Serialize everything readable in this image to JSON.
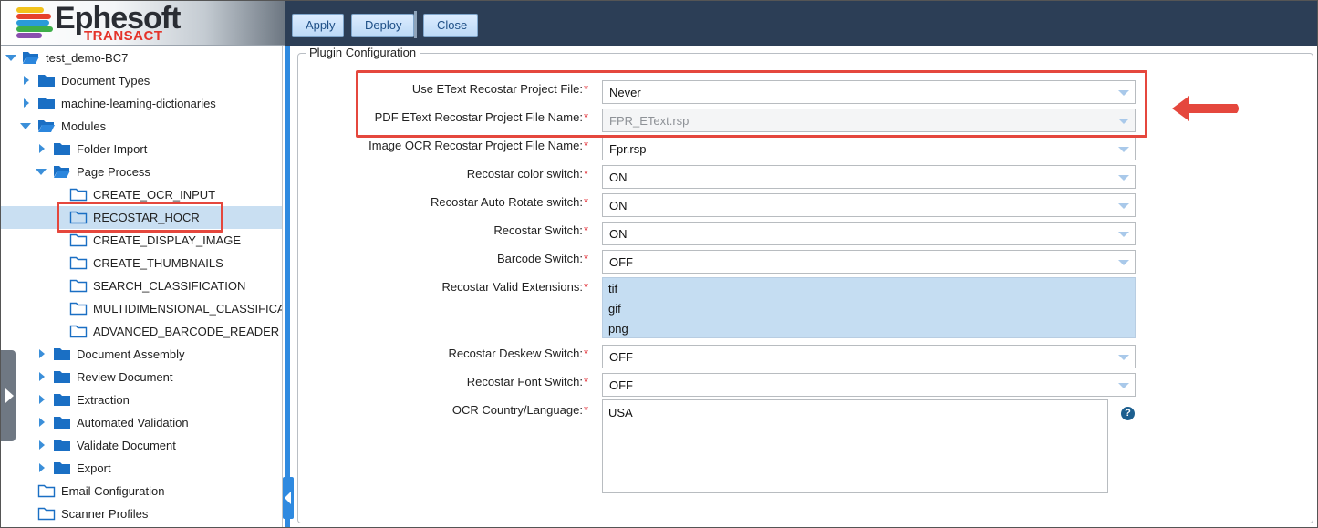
{
  "brand": {
    "name": "Ephesoft",
    "product": "TRANSACT"
  },
  "toolbar": {
    "apply": "Apply",
    "deploy": "Deploy",
    "close": "Close"
  },
  "tree": {
    "root": "test_demo-BC7",
    "document_types": "Document Types",
    "ml_dictionaries": "machine-learning-dictionaries",
    "modules": "Modules",
    "folder_import": "Folder Import",
    "page_process": "Page Process",
    "plugins": [
      "CREATE_OCR_INPUT",
      "RECOSTAR_HOCR",
      "CREATE_DISPLAY_IMAGE",
      "CREATE_THUMBNAILS",
      "SEARCH_CLASSIFICATION",
      "MULTIDIMENSIONAL_CLASSIFICATION",
      "ADVANCED_BARCODE_READER"
    ],
    "document_assembly": "Document Assembly",
    "review_document": "Review Document",
    "extraction": "Extraction",
    "automated_validation": "Automated Validation",
    "validate_document": "Validate Document",
    "export": "Export",
    "email_configuration": "Email Configuration",
    "scanner_profiles": "Scanner Profiles",
    "selected": "RECOSTAR_HOCR"
  },
  "plugin_config": {
    "legend": "Plugin Configuration",
    "required_mark": "*",
    "fields": [
      {
        "label": "Use EText Recostar Project File:",
        "value": "Never"
      },
      {
        "label": "PDF EText Recostar Project File Name:",
        "value": "FPR_EText.rsp",
        "disabled": true
      },
      {
        "label": "Image OCR Recostar Project File Name:",
        "value": "Fpr.rsp"
      },
      {
        "label": "Recostar color switch:",
        "value": "ON"
      },
      {
        "label": "Recostar Auto Rotate switch:",
        "value": "ON"
      },
      {
        "label": "Recostar Switch:",
        "value": "ON"
      },
      {
        "label": "Barcode Switch:",
        "value": "OFF"
      },
      {
        "label": "Recostar Valid Extensions:",
        "options": [
          "tif",
          "gif",
          "png"
        ]
      },
      {
        "label": "Recostar Deskew Switch:",
        "value": "OFF"
      },
      {
        "label": "Recostar Font Switch:",
        "value": "OFF"
      },
      {
        "label": "OCR Country/Language:",
        "value": "USA"
      }
    ],
    "help_glyph": "?"
  },
  "colors": {
    "highlight": "#e5473d",
    "accent": "#2f8ae0",
    "toolbar_bg": "#2c3e56",
    "selection": "#c9dff2"
  }
}
